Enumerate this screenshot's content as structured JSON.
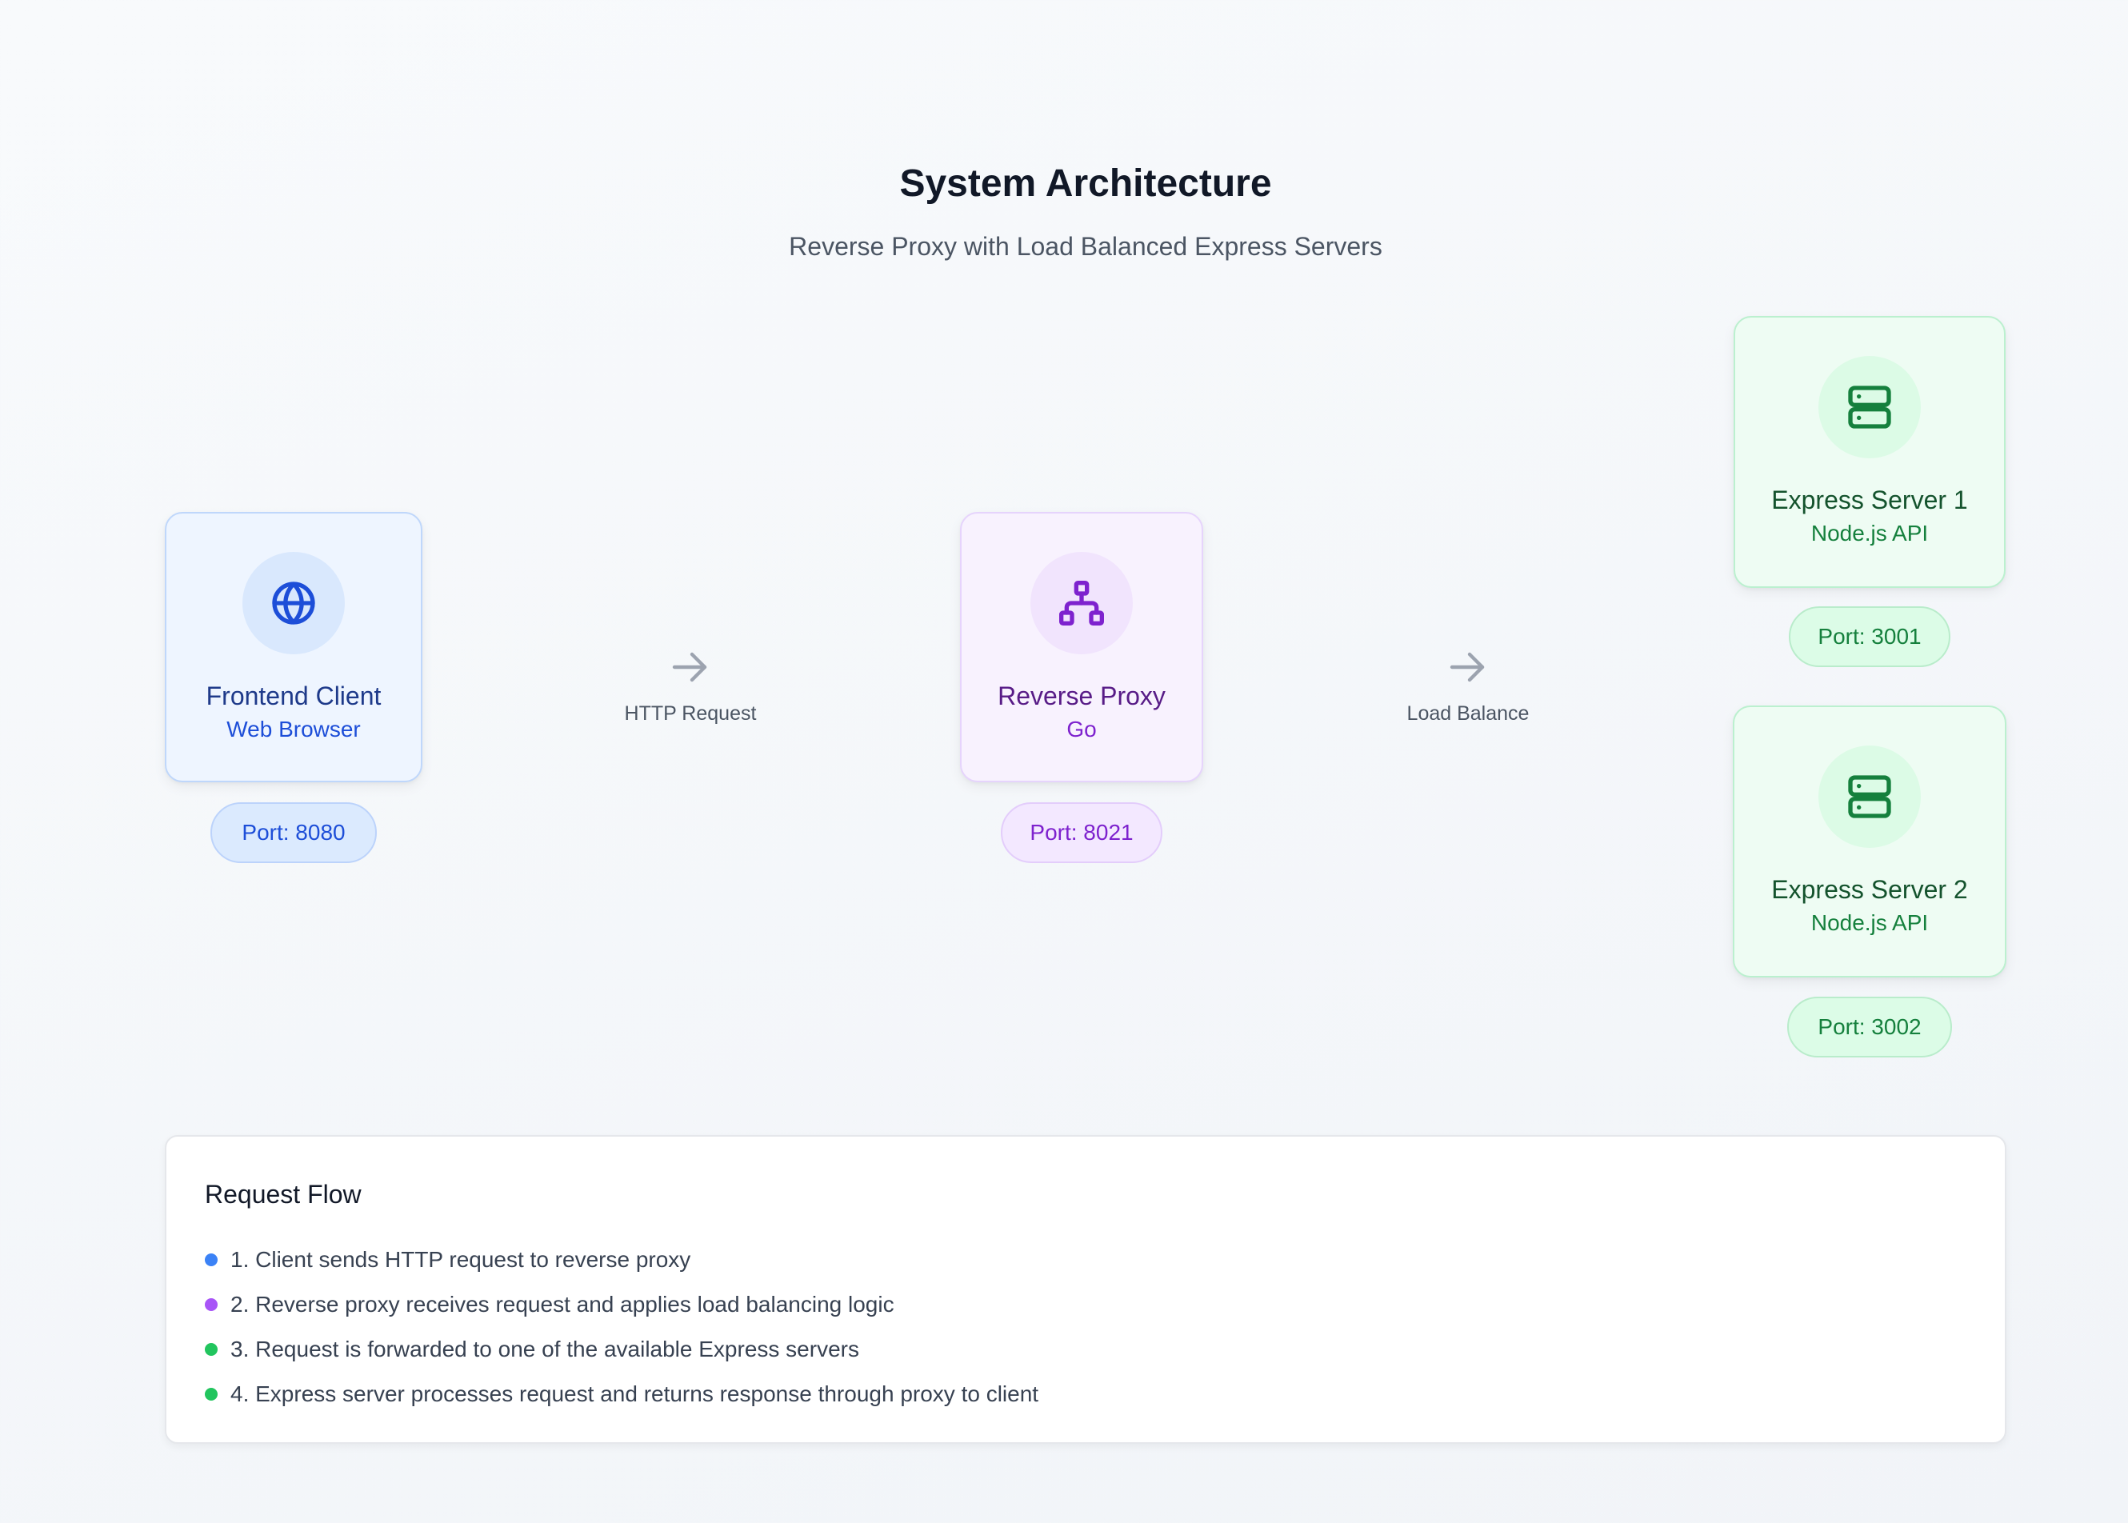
{
  "header": {
    "title": "System Architecture",
    "subtitle": "Reverse Proxy with Load Balanced Express Servers"
  },
  "nodes": {
    "client": {
      "name": "Frontend Client",
      "sub": "Web Browser",
      "port": "Port: 8080",
      "icon": "globe-icon",
      "accent": "#1d4ed8"
    },
    "proxy": {
      "name": "Reverse Proxy",
      "sub": "Go",
      "port": "Port: 8021",
      "icon": "network-icon",
      "accent": "#7e22ce"
    },
    "server1": {
      "name": "Express Server 1",
      "sub": "Node.js API",
      "port": "Port: 3001",
      "icon": "server-icon",
      "accent": "#15803d"
    },
    "server2": {
      "name": "Express Server 2",
      "sub": "Node.js API",
      "port": "Port: 3002",
      "icon": "server-icon",
      "accent": "#15803d"
    }
  },
  "edges": {
    "client_to_proxy": "HTTP Request",
    "proxy_to_servers": "Load Balance"
  },
  "flow": {
    "title": "Request Flow",
    "steps": [
      {
        "text": "1. Client sends HTTP request to reverse proxy",
        "color": "#3b82f6"
      },
      {
        "text": "2. Reverse proxy receives request and applies load balancing logic",
        "color": "#a855f7"
      },
      {
        "text": "3. Request is forwarded to one of the available Express servers",
        "color": "#22c55e"
      },
      {
        "text": "4. Express server processes request and returns response through proxy to client",
        "color": "#22c55e"
      }
    ]
  }
}
